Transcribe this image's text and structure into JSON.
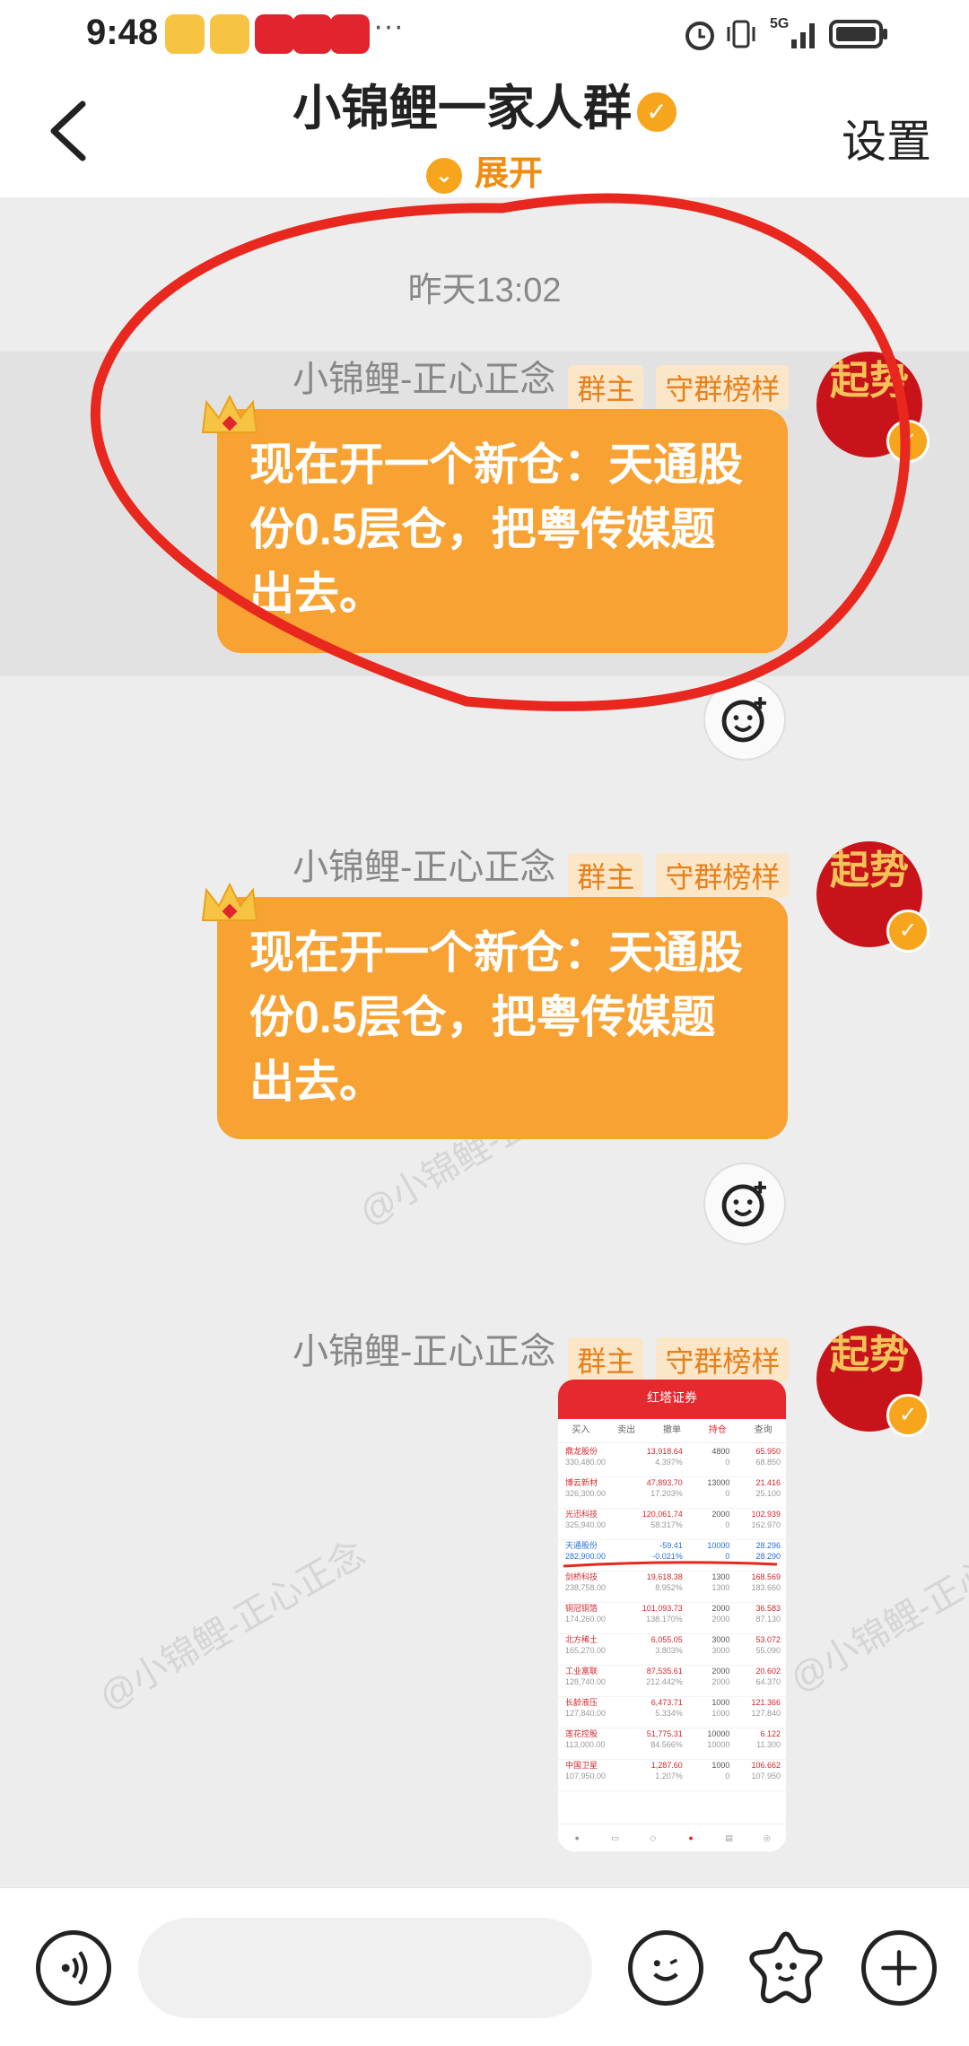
{
  "status_bar": {
    "time": "9:48",
    "network": "5G"
  },
  "header": {
    "title": "小锦鲤一家人群",
    "expand_label": "展开",
    "settings_label": "设置"
  },
  "chat": {
    "timestamp": "昨天13:02",
    "messages": [
      {
        "sender": "小锦鲤-正心正念",
        "tags": [
          "群主",
          "守群榜样"
        ],
        "text": "现在开一个新仓：天通股份0.5层仓，把粤传媒题出去。"
      },
      {
        "sender": "小锦鲤-正心正念",
        "tags": [
          "群主",
          "守群榜样"
        ],
        "text": "现在开一个新仓：天通股份0.5层仓，把粤传媒题出去。"
      },
      {
        "sender": "小锦鲤-正心正念",
        "tags": [
          "群主",
          "守群榜样"
        ]
      }
    ],
    "avatar_text": "起势",
    "watermark": "@小锦鲤-正心正念"
  },
  "screenshot": {
    "app_title": "红塔证券",
    "tabs": [
      "买入",
      "卖出",
      "撤单",
      "持仓",
      "查询"
    ],
    "rows": [
      {
        "name": "鼎龙股份",
        "sub": "330,480.00",
        "pl": "13,918.64",
        "pl_pct": "4.397%",
        "qty": "4800",
        "qty2": "0",
        "price": "65.950",
        "price2": "68.850"
      },
      {
        "name": "博云新材",
        "sub": "326,300.00",
        "pl": "47,893.70",
        "pl_pct": "17.203%",
        "qty": "13000",
        "qty2": "0",
        "price": "21.416",
        "price2": "25.100"
      },
      {
        "name": "光迅科技",
        "sub": "325,940.00",
        "pl": "120,061.74",
        "pl_pct": "58.317%",
        "qty": "2000",
        "qty2": "0",
        "price": "102.939",
        "price2": "162.970"
      },
      {
        "name": "天通股份",
        "sub": "282,900.00",
        "pl": "-59.41",
        "pl_pct": "-0.021%",
        "qty": "10000",
        "qty2": "0",
        "price": "28.296",
        "price2": "28.290"
      },
      {
        "name": "剑桥科技",
        "sub": "238,758.00",
        "pl": "19,618.38",
        "pl_pct": "8.952%",
        "qty": "1300",
        "qty2": "1300",
        "price": "168.569",
        "price2": "183.660"
      },
      {
        "name": "铜冠铜箔",
        "sub": "174,260.00",
        "pl": "101,093.73",
        "pl_pct": "138.170%",
        "qty": "2000",
        "qty2": "2000",
        "price": "36.583",
        "price2": "87.130"
      },
      {
        "name": "北方稀土",
        "sub": "165,270.00",
        "pl": "6,055.05",
        "pl_pct": "3.803%",
        "qty": "3000",
        "qty2": "3000",
        "price": "53.072",
        "price2": "55.090"
      },
      {
        "name": "工业富联",
        "sub": "128,740.00",
        "pl": "87,535.61",
        "pl_pct": "212.442%",
        "qty": "2000",
        "qty2": "2000",
        "price": "20.602",
        "price2": "64.370"
      },
      {
        "name": "长龄液压",
        "sub": "127,840.00",
        "pl": "6,473.71",
        "pl_pct": "5.334%",
        "qty": "1000",
        "qty2": "1000",
        "price": "121.366",
        "price2": "127.840"
      },
      {
        "name": "莲花控股",
        "sub": "113,000.00",
        "pl": "51,775.31",
        "pl_pct": "84.566%",
        "qty": "10000",
        "qty2": "10000",
        "price": "6.122",
        "price2": "11.300"
      },
      {
        "name": "中国卫星",
        "sub": "107,950.00",
        "pl": "1,287.60",
        "pl_pct": "1.207%",
        "qty": "1000",
        "qty2": "0",
        "price": "106.662",
        "price2": "107.950"
      }
    ]
  },
  "colors": {
    "accent": "#f7a233",
    "tag_bg": "#fbe6c8",
    "tag_fg": "#e8801a",
    "annotation": "#e8281e",
    "avatar": "#c8131a"
  }
}
